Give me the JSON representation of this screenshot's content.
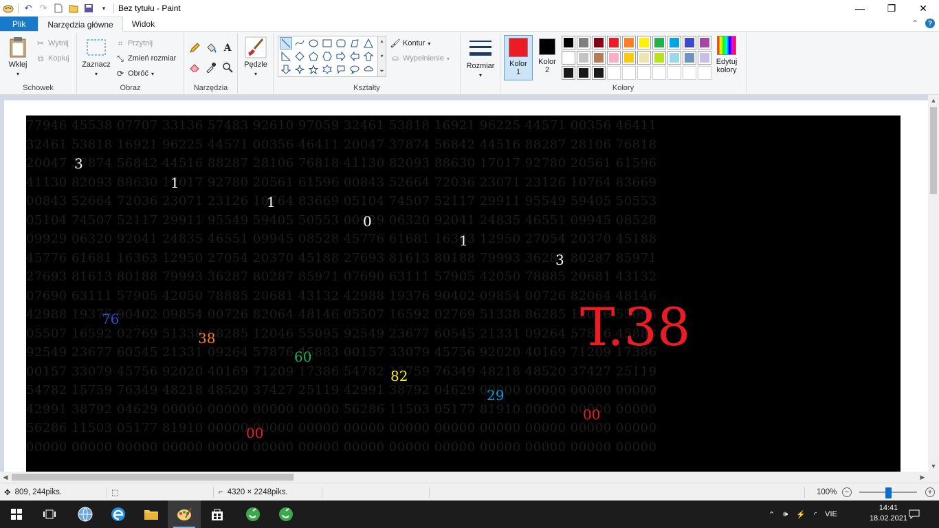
{
  "window": {
    "title": "Bez tytułu - Paint",
    "minimize_icon": "minimize-icon",
    "restore_icon": "restore-icon",
    "close_icon": "close-icon"
  },
  "tabs": [
    {
      "label": "Plik"
    },
    {
      "label": "Narzędzia główne"
    },
    {
      "label": "Widok"
    }
  ],
  "ribbon": {
    "clipboard": {
      "title": "Schowek",
      "paste": "Wklej",
      "cut": "Wytnij",
      "copy": "Kopiuj"
    },
    "image": {
      "title": "Obraz",
      "select": "Zaznacz",
      "crop": "Przytnij",
      "resize": "Zmień rozmiar",
      "rotate": "Obróć"
    },
    "tools": {
      "title": "Narzędzia",
      "brushes": "Pędzle"
    },
    "shapes": {
      "title": "Kształty",
      "outline": "Kontur",
      "fill": "Wypełnienie"
    },
    "size": {
      "label": "Rozmiar"
    },
    "colors": {
      "title": "Kolory",
      "color1_line1": "Kolor",
      "color1_line2": "1",
      "color2_line1": "Kolor",
      "color2_line2": "2",
      "edit_line1": "Edytuj",
      "edit_line2": "kolory",
      "color1_value": "#ed1c24",
      "color2_value": "#000000",
      "palette_row1": [
        "#000000",
        "#7f7f7f",
        "#880015",
        "#ed1c24",
        "#ff7f27",
        "#fff200",
        "#22b14c",
        "#00a2e8",
        "#3f48cc",
        "#a349a4"
      ],
      "palette_row2": [
        "#ffffff",
        "#c3c3c3",
        "#b97a57",
        "#ffaec9",
        "#ffc90e",
        "#efe4b0",
        "#b5e61d",
        "#99d9ea",
        "#7092be",
        "#c8bfe7"
      ],
      "palette_row3": [
        "#1a1a1a",
        "#1a1a1a",
        "#1a1a1a"
      ]
    }
  },
  "canvas": {
    "background_rows": [
      "77946 45538 07707 33136 57483 92610 97059 32461 53818 16921 96225 44571 00356 46411",
      "32461 53818 16921 96225 44571 00356 46411 20047 37874 56842 44516 88287 28106 76818",
      "20047 37874 56842 44516 88287 28106 76818 41130 82093 88630 17017 92780 20561 61596",
      "41130 82093 88630 17017 92780 20561 61596 00843 52664 72036 23071 23126 10764 83669",
      "00843 52664 72036 23071 23126 10764 83669 05104 74507 52117 29911 95549 59405 50553",
      "05104 74507 52117 29911 95549 59405 50553 00929 06320 92041 24835 46551 09945 08528",
      "09929 06320 92041 24835 46551 09945 08528 45776 61681 16363 12950 27054 20370 45188",
      "45776 61681 16363 12950 27054 20370 45188 27693 81613 80188 79993 36287 80287 85971",
      "27693 81613 80188 79993 36287 80287 85971 07690 63111 57905 42050 78885 20681 43132",
      "07690 63111 57905 42050 78885 20681 43132 42988 19376 90402 09854 00726 82064 48146",
      "42988 19376 90402 09854 00726 82064 48146 05507 16592 02769 51338 86285 12046 55095",
      "05507 16592 02769 51338 68285 12046 55095 92549 23677 60545 21331 09264 57876 45883",
      "92549 23677 60545 21331 09264 57876 45883 00157 33079 45756 92020 40169 71209 17386",
      "00157 33079 45756 92020 40169 71209 17386 54782 15759 76349 48218 48520 37427 25119",
      "54782 15759 76349 48218 48520 37427 25119 42991 38792 04629 00000 00000 00000 00000",
      "42991 38792 04629 00000 00000 00000 00000 56286 11503 05177 81910 00000 00000 00000",
      "56286 11503 05177 81910 00000 00000 00000 00000 00000 00000 00000 00000 00000 00000",
      "00000 00000 00000 00000 00000 00000 00000 00000 00000 00000 00000 00000 00000 00000"
    ],
    "white_digits": [
      "3",
      "1",
      "1",
      "0",
      "1",
      "3"
    ],
    "colored_numbers": [
      {
        "text": "76",
        "color": "#3f48cc"
      },
      {
        "text": "38",
        "color": "#ff7f27"
      },
      {
        "text": "60",
        "color": "#22b14c"
      },
      {
        "text": "82",
        "color": "#fff200"
      },
      {
        "text": "29",
        "color": "#00a2e8"
      },
      {
        "text": "00",
        "color": "#ed1c24"
      },
      {
        "text": "00",
        "color": "#ed1c24"
      }
    ],
    "big_label": "T.38",
    "big_label_color": "#ed1c24"
  },
  "statusbar": {
    "cursor_pos": "809, 244piks.",
    "image_size": "4320 × 2248piks.",
    "zoom": "100%"
  },
  "taskbar": {
    "language": "VIE",
    "time": "14:41",
    "date": "18.02.2021"
  }
}
